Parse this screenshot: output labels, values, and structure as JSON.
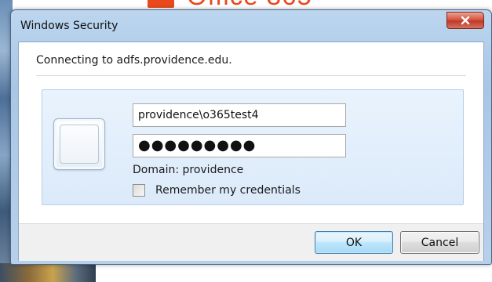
{
  "dialog": {
    "title": "Windows Security",
    "close_icon": "close-x-icon"
  },
  "message": "Connecting to adfs.providence.edu.",
  "credentials": {
    "user_tile_icon": "user-tile-icon",
    "username_value": "providence\\o365test4",
    "password_value": "●●●●●●●●●",
    "domain_label": "Domain: providence",
    "remember_label": "Remember my credentials",
    "remember_checked": false
  },
  "buttons": {
    "ok_label": "OK",
    "cancel_label": "Cancel"
  },
  "colors": {
    "titlebar": "#b7d0ea",
    "close_button": "#c0392b",
    "credential_panel": "#dbeafa",
    "background_logo": "#e8491d"
  }
}
